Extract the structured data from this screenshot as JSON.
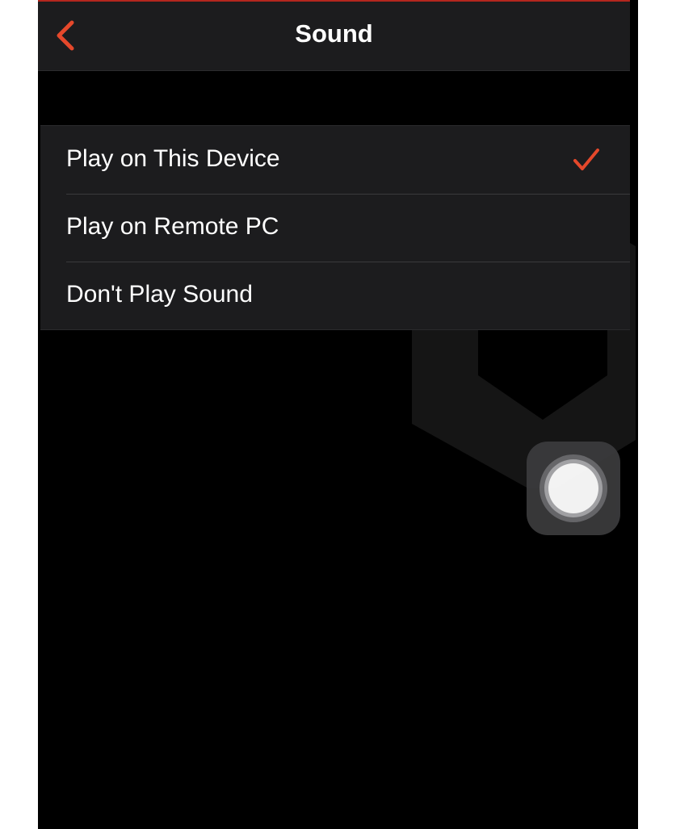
{
  "nav": {
    "title": "Sound",
    "back_icon": "chevron-left-icon"
  },
  "options": [
    {
      "label": "Play on This Device",
      "selected": true
    },
    {
      "label": "Play on Remote PC",
      "selected": false
    },
    {
      "label": "Don't Play Sound",
      "selected": false
    }
  ],
  "colors": {
    "accent": "#e5482b",
    "background": "#000000",
    "cell": "#1c1c1e"
  },
  "icons": {
    "check": "checkmark-icon",
    "assistive": "assistive-touch-icon",
    "watermark": "logo-watermark"
  }
}
